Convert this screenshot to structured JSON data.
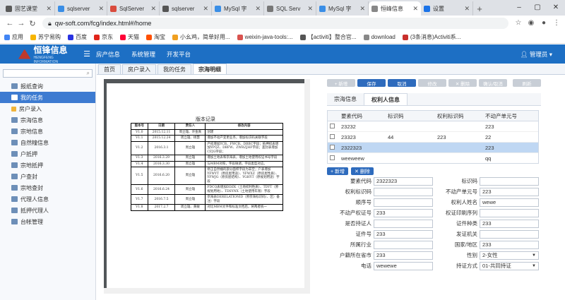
{
  "browser": {
    "tabs": [
      {
        "label": "固艺课堂",
        "color": "#5a5a5a"
      },
      {
        "label": "sqlserver",
        "color": "#3a8ee6"
      },
      {
        "label": "SqlServer",
        "color": "#d94b3d"
      },
      {
        "label": "sqlserver",
        "color": "#555555"
      },
      {
        "label": "MySql 字",
        "color": "#3a8ee6"
      },
      {
        "label": "SQL Serv",
        "color": "#777777"
      },
      {
        "label": "MySql 字",
        "color": "#3a8ee6"
      },
      {
        "label": "恒峰信息",
        "color": "#888888"
      },
      {
        "label": "设置",
        "color": "#1a73e8"
      }
    ],
    "url": "qw-soft.com/fcg/index.html#/home",
    "bookmarks": [
      {
        "label": "应用",
        "color": "#4285f4"
      },
      {
        "label": "苏宁易购",
        "color": "#f7b500"
      },
      {
        "label": "百度",
        "color": "#2932e1"
      },
      {
        "label": "京东",
        "color": "#e1251b"
      },
      {
        "label": "天猫",
        "color": "#ff0036"
      },
      {
        "label": "淘宝",
        "color": "#ff5000"
      },
      {
        "label": "小幺鸡，简单好用...",
        "color": "#f0a020"
      },
      {
        "label": "weixin-java-tools:...",
        "color": "#d9534f"
      },
      {
        "label": "【activiti】整合官...",
        "color": "#555555"
      },
      {
        "label": "download",
        "color": "#888888"
      },
      {
        "label": "(3条消息)Activiti系...",
        "color": "#c9302c"
      }
    ]
  },
  "app": {
    "brand": "恒锋信息",
    "brand_sub": "HENGFENG INFORMATION",
    "nav": [
      "房产信息",
      "系统管理",
      "开发平台"
    ],
    "user": "管理员 ▾"
  },
  "sidebar": {
    "search_placeholder": "搜索",
    "items": [
      {
        "label": "报纸查询",
        "active": false
      },
      {
        "label": "我的任务",
        "active": true
      },
      {
        "label": "房户录入",
        "active": false
      },
      {
        "label": "宗海信息",
        "active": false
      },
      {
        "label": "宗地信息",
        "active": false
      },
      {
        "label": "自然幢信息",
        "active": false
      },
      {
        "label": "户抵押",
        "active": false
      },
      {
        "label": "宗地抵押",
        "active": false
      },
      {
        "label": "户查封",
        "active": false
      },
      {
        "label": "宗地查封",
        "active": false
      },
      {
        "label": "代理人信息",
        "active": false
      },
      {
        "label": "抵押代理人",
        "active": false
      },
      {
        "label": "台帐管理",
        "active": false
      }
    ]
  },
  "page_tabs": [
    {
      "label": "首页",
      "active": false
    },
    {
      "label": "房户录入",
      "active": false
    },
    {
      "label": "我的任务",
      "active": false
    },
    {
      "label": "宗海明细",
      "active": true
    }
  ],
  "doc": {
    "title": "版本记录",
    "headers": [
      "版本号",
      "日期",
      "责任人",
      "修改内容"
    ],
    "rows": [
      [
        "V1.0",
        "2015.12.11",
        "周立雄、许金真",
        "创建"
      ],
      [
        "V1.1",
        "2015.12.24",
        "周立雄、杨慧",
        "增加不动产变更业务，增加标识码关联字段"
      ],
      [
        "V1.2",
        "2016.3.1",
        "周立雄",
        "产权增加YCB、FWCB、DBBC字段；抵押权表增加YPQZ、DBFW、ZWRZJHF字段；查封表增加CFJG字段；"
      ],
      [
        "V1.3",
        "2016.3.29",
        "周立雄",
        "增加土地表和宗海表，增加土地使用权证书号字段"
      ],
      [
        "V1.4",
        "2016.3.30",
        "周立雄",
        "与MBM对照，字段微调，字段类型对应。"
      ],
      [
        "V1.5",
        "2016.6.20",
        "周立雄",
        "修正自然幢的部分面积字段为非空；户表增加YFWYT（原房屋用途）、YFWXZ（原房屋性质）、YFWJG（原房屋结构）、YGHYT（原规划用途）字段"
      ],
      [
        "V1.6",
        "2016.6.24",
        "周立雄",
        "FDCQ表增加DDZK（土地权利性质）、TDYT（原规划用地）、TDSYNX（土地使用年限）字段"
      ],
      [
        "V1.7",
        "2016.7.5",
        "周立雄",
        "宗海表DERELATIONID（原宗海标识码）、区）备注）字段"
      ],
      [
        "V1.8",
        "2017.2.7",
        "周立雄、黄敏",
        "对比MBM文件和标准文档后，将两者统一"
      ]
    ]
  },
  "toolbar": [
    {
      "label": "+ 新增",
      "primary": false
    },
    {
      "label": "保存",
      "primary": true
    },
    {
      "label": "取消",
      "primary": true
    },
    {
      "label": "修改",
      "primary": false
    },
    {
      "label": "✕ 删除",
      "primary": false
    },
    {
      "label": "确认/取消",
      "primary": false
    },
    {
      "label": "刷新",
      "primary": false
    }
  ],
  "subtabs": [
    {
      "label": "宗海信息",
      "active": false
    },
    {
      "label": "权利人信息",
      "active": true
    }
  ],
  "grid": {
    "headers": [
      "要素代码",
      "标识码",
      "权利标识码",
      "不动产单元号"
    ],
    "rows": [
      {
        "cells": [
          "23232",
          "",
          "",
          "223"
        ],
        "selected": false
      },
      {
        "cells": [
          "23323",
          "44",
          "223",
          "22"
        ],
        "selected": false
      },
      {
        "cells": [
          "2322323",
          "",
          "",
          "223"
        ],
        "selected": true
      },
      {
        "cells": [
          "weeweew",
          "",
          "",
          "qq"
        ],
        "selected": false
      }
    ],
    "add_label": "+ 新增",
    "delete_label": "✕ 删除"
  },
  "form": [
    {
      "label": "要素代码",
      "value": "2322323"
    },
    {
      "label": "标识码",
      "value": ""
    },
    {
      "label": "权利标识码",
      "value": ""
    },
    {
      "label": "不动产单元号",
      "value": "223"
    },
    {
      "label": "顺序号",
      "value": ""
    },
    {
      "label": "权利人姓名",
      "value": "wewe"
    },
    {
      "label": "不动产权证号",
      "value": "233"
    },
    {
      "label": "权证印刷序列",
      "value": ""
    },
    {
      "label": "是否持证人",
      "value": ""
    },
    {
      "label": "证件种类",
      "value": "233"
    },
    {
      "label": "证件号",
      "value": "233"
    },
    {
      "label": "发证机关",
      "value": ""
    },
    {
      "label": "所属行业",
      "value": ""
    },
    {
      "label": "国家/地区",
      "value": "233"
    },
    {
      "label": "户籍所在省市",
      "value": "233"
    },
    {
      "label": "性别",
      "value": "2-女性",
      "dropdown": true
    },
    {
      "label": "电话",
      "value": "wewewe"
    },
    {
      "label": "持证方式",
      "value": "01-共同持证",
      "dropdown": true
    }
  ]
}
